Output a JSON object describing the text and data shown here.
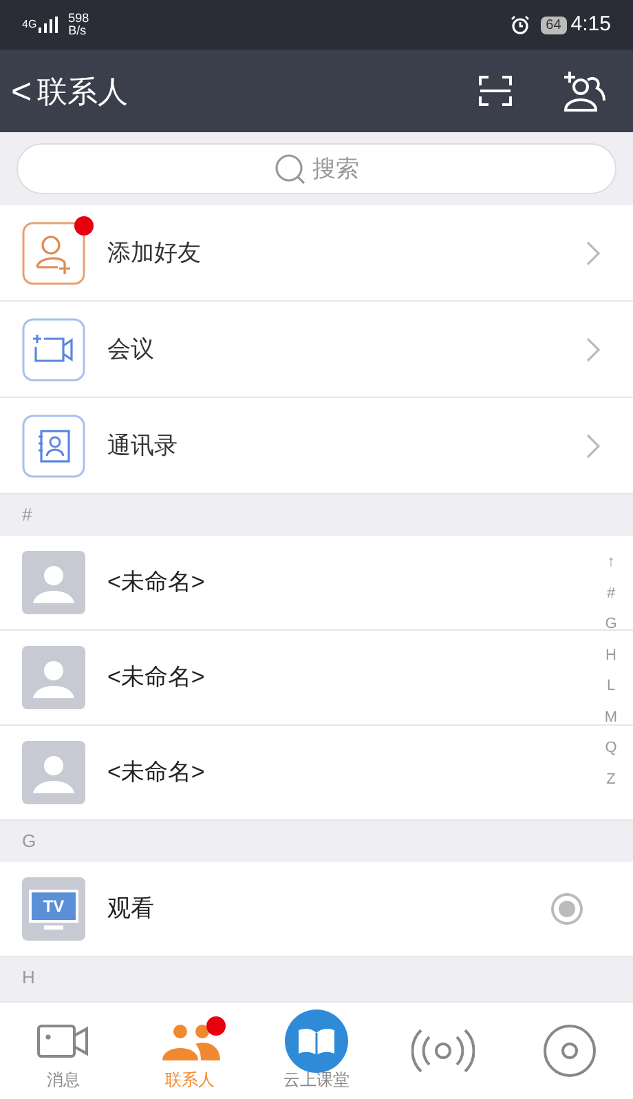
{
  "status_bar": {
    "network": "4G",
    "speed_value": "598",
    "speed_unit": "B/s",
    "battery": "64",
    "time": "4:15"
  },
  "header": {
    "back": "<",
    "title": "联系人"
  },
  "search": {
    "placeholder": "搜索"
  },
  "quick_actions": [
    {
      "kind": "add-friend",
      "label": "添加好友",
      "badge": true
    },
    {
      "kind": "meeting",
      "label": "会议",
      "badge": false
    },
    {
      "kind": "address-book",
      "label": "通讯录",
      "badge": false
    }
  ],
  "sections": [
    {
      "header": "#",
      "contacts": [
        {
          "kind": "person",
          "name": "<未命名>"
        },
        {
          "kind": "person",
          "name": "<未命名>"
        },
        {
          "kind": "person",
          "name": "<未命名>"
        }
      ]
    },
    {
      "header": "G",
      "contacts": [
        {
          "kind": "tv",
          "name": "观看",
          "icon_text": "TV"
        }
      ]
    },
    {
      "header": "H"
    }
  ],
  "index": [
    "↑",
    "#",
    "G",
    "H",
    "L",
    "M",
    "Q",
    "Z"
  ],
  "tabs": [
    {
      "kind": "video",
      "label": "消息",
      "selected": false,
      "badge": false
    },
    {
      "kind": "people",
      "label": "联系人",
      "selected": true,
      "badge": true
    },
    {
      "kind": "book",
      "label": "云上课堂",
      "selected": false,
      "badge": false
    },
    {
      "kind": "radar",
      "selected": false,
      "badge": false
    },
    {
      "kind": "disc",
      "selected": false,
      "badge": false
    }
  ]
}
